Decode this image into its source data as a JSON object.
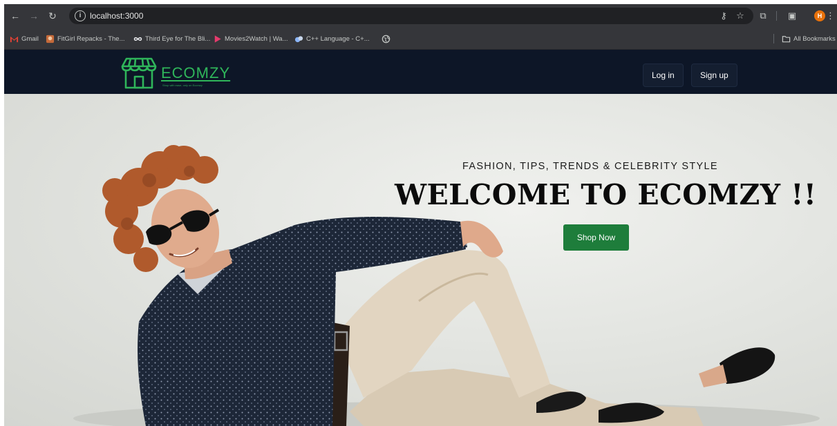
{
  "browser": {
    "url": "localhost:3000",
    "bookmarks": [
      {
        "label": "Gmail",
        "icon": "gmail-icon"
      },
      {
        "label": "FitGirl Repacks - The...",
        "icon": "fitgirl-icon"
      },
      {
        "label": "Third Eye for The Bli...",
        "icon": "infinity-icon"
      },
      {
        "label": "Movies2Watch | Wa...",
        "icon": "play-icon"
      },
      {
        "label": "C++ Language - C+...",
        "icon": "cplusplus-icon"
      }
    ],
    "all_bookmarks_label": "All Bookmarks",
    "profile_initial": "H"
  },
  "site": {
    "logo_text": "ECOMZY",
    "logo_tagline": "Shop with ease, only on Ecomzy",
    "nav": {
      "login_label": "Log in",
      "signup_label": "Sign up"
    }
  },
  "hero": {
    "subtitle": "FASHION, TIPS, TRENDS & CELEBRITY STYLE",
    "title": "WELCOME TO ECOMZY !!",
    "cta_label": "Shop Now"
  },
  "colors": {
    "navbar_bg": "#0d1627",
    "brand_green": "#2fb55a",
    "cta_green": "#1e7d3b",
    "chrome_toolbar": "#35363a"
  }
}
